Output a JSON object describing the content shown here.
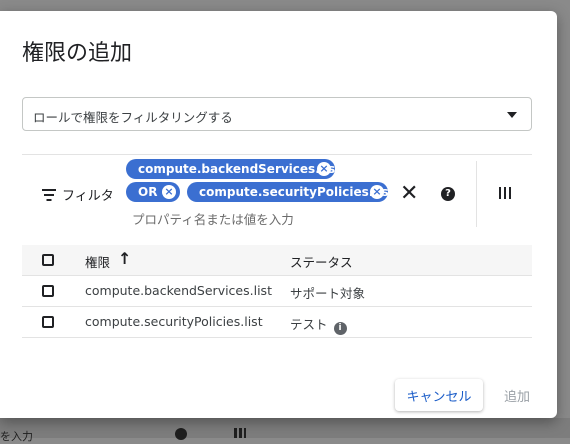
{
  "dialog": {
    "title": "権限の追加",
    "role_filter_placeholder": "ロールで権限をフィルタリングする"
  },
  "filter": {
    "label": "フィルタ",
    "chips": [
      {
        "label": "compute.backendServices.list"
      },
      {
        "label": "OR"
      },
      {
        "label": "compute.securityPolicies.list"
      }
    ],
    "input_placeholder": "プロパティ名または値を入力",
    "clear_icon": "close-icon",
    "help_icon": "help-icon",
    "columns_icon": "column-display-icon"
  },
  "table": {
    "columns": [
      "権限",
      "ステータス"
    ],
    "sort_icon": "arrow-upward-icon",
    "rows": [
      {
        "permission": "compute.backendServices.list",
        "status": "サポート対象",
        "info": false
      },
      {
        "permission": "compute.securityPolicies.list",
        "status": "テスト",
        "info": true
      }
    ]
  },
  "actions": {
    "cancel": "キャンセル",
    "add": "追加"
  },
  "colors": {
    "accent": "#1a5cc8",
    "chip": "#3b6fd1",
    "disabled": "#9aa0a6"
  },
  "backdrop": {
    "partial_text": "を入力"
  }
}
